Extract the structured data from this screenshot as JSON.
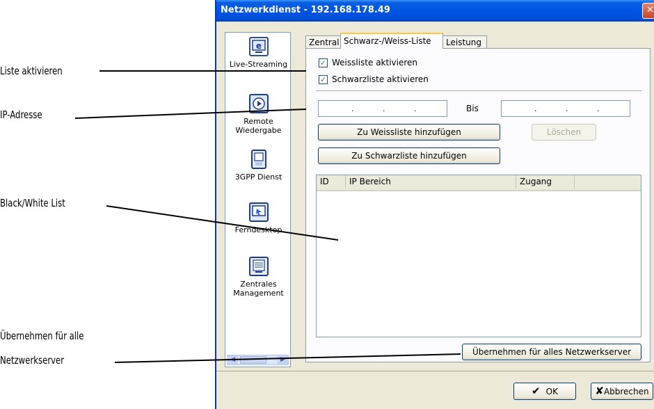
{
  "callouts": {
    "liste": "Liste aktivieren",
    "ip": "IP-Adresse",
    "bwlist": "Black/White List",
    "apply_line1": "Übernehmen für alle",
    "apply_line2": "Netzwerkserver"
  },
  "window": {
    "title": "Netzwerkdienst - 192.168.178.49",
    "close_glyph": "✕"
  },
  "sidebar": {
    "items": [
      {
        "label": "Live-Streaming",
        "icon": "live-streaming-icon"
      },
      {
        "label": "Remote",
        "label2": "Wiedergabe",
        "icon": "remote-playback-icon"
      },
      {
        "label": "3GPP Dienst",
        "icon": "3gpp-device-icon"
      },
      {
        "label": "Ferndesktop",
        "icon": "remote-desktop-icon"
      },
      {
        "label": "Zentrales",
        "label2": "Management",
        "icon": "central-management-icon"
      }
    ],
    "scroll_left": "◀",
    "scroll_right": "▶"
  },
  "tabs": [
    {
      "label": "Zentral"
    },
    {
      "label": "Schwarz-/Weiss-Liste",
      "active": true
    },
    {
      "label": "Leistung"
    }
  ],
  "panel": {
    "whitelist_checkbox": {
      "label": "Weissliste aktivieren",
      "checked": true
    },
    "blacklist_checkbox": {
      "label": "Schwarzliste aktivieren",
      "checked": true
    },
    "check_glyph": "✓",
    "ip_from_dots": [
      ".",
      ".",
      "."
    ],
    "bis_label": "Bis",
    "ip_to_dots": [
      ".",
      ".",
      "."
    ],
    "add_whitelist": "Zu Weissliste hinzufügen",
    "delete": "Löschen",
    "add_blacklist": "Zu Schwarzliste hinzufügen",
    "columns": [
      "ID",
      "IP Bereich",
      "Zugang"
    ],
    "apply_all": "Übernehmen für alles Netzwerkserver"
  },
  "footer": {
    "ok": "OK",
    "ok_glyph": "✔",
    "cancel": "Abbrechen",
    "cancel_glyph": "✘"
  },
  "colors": {
    "titlebar": "#0054e3",
    "dialog_bg": "#ece9d8",
    "tab_highlight": "#ffc73c"
  }
}
